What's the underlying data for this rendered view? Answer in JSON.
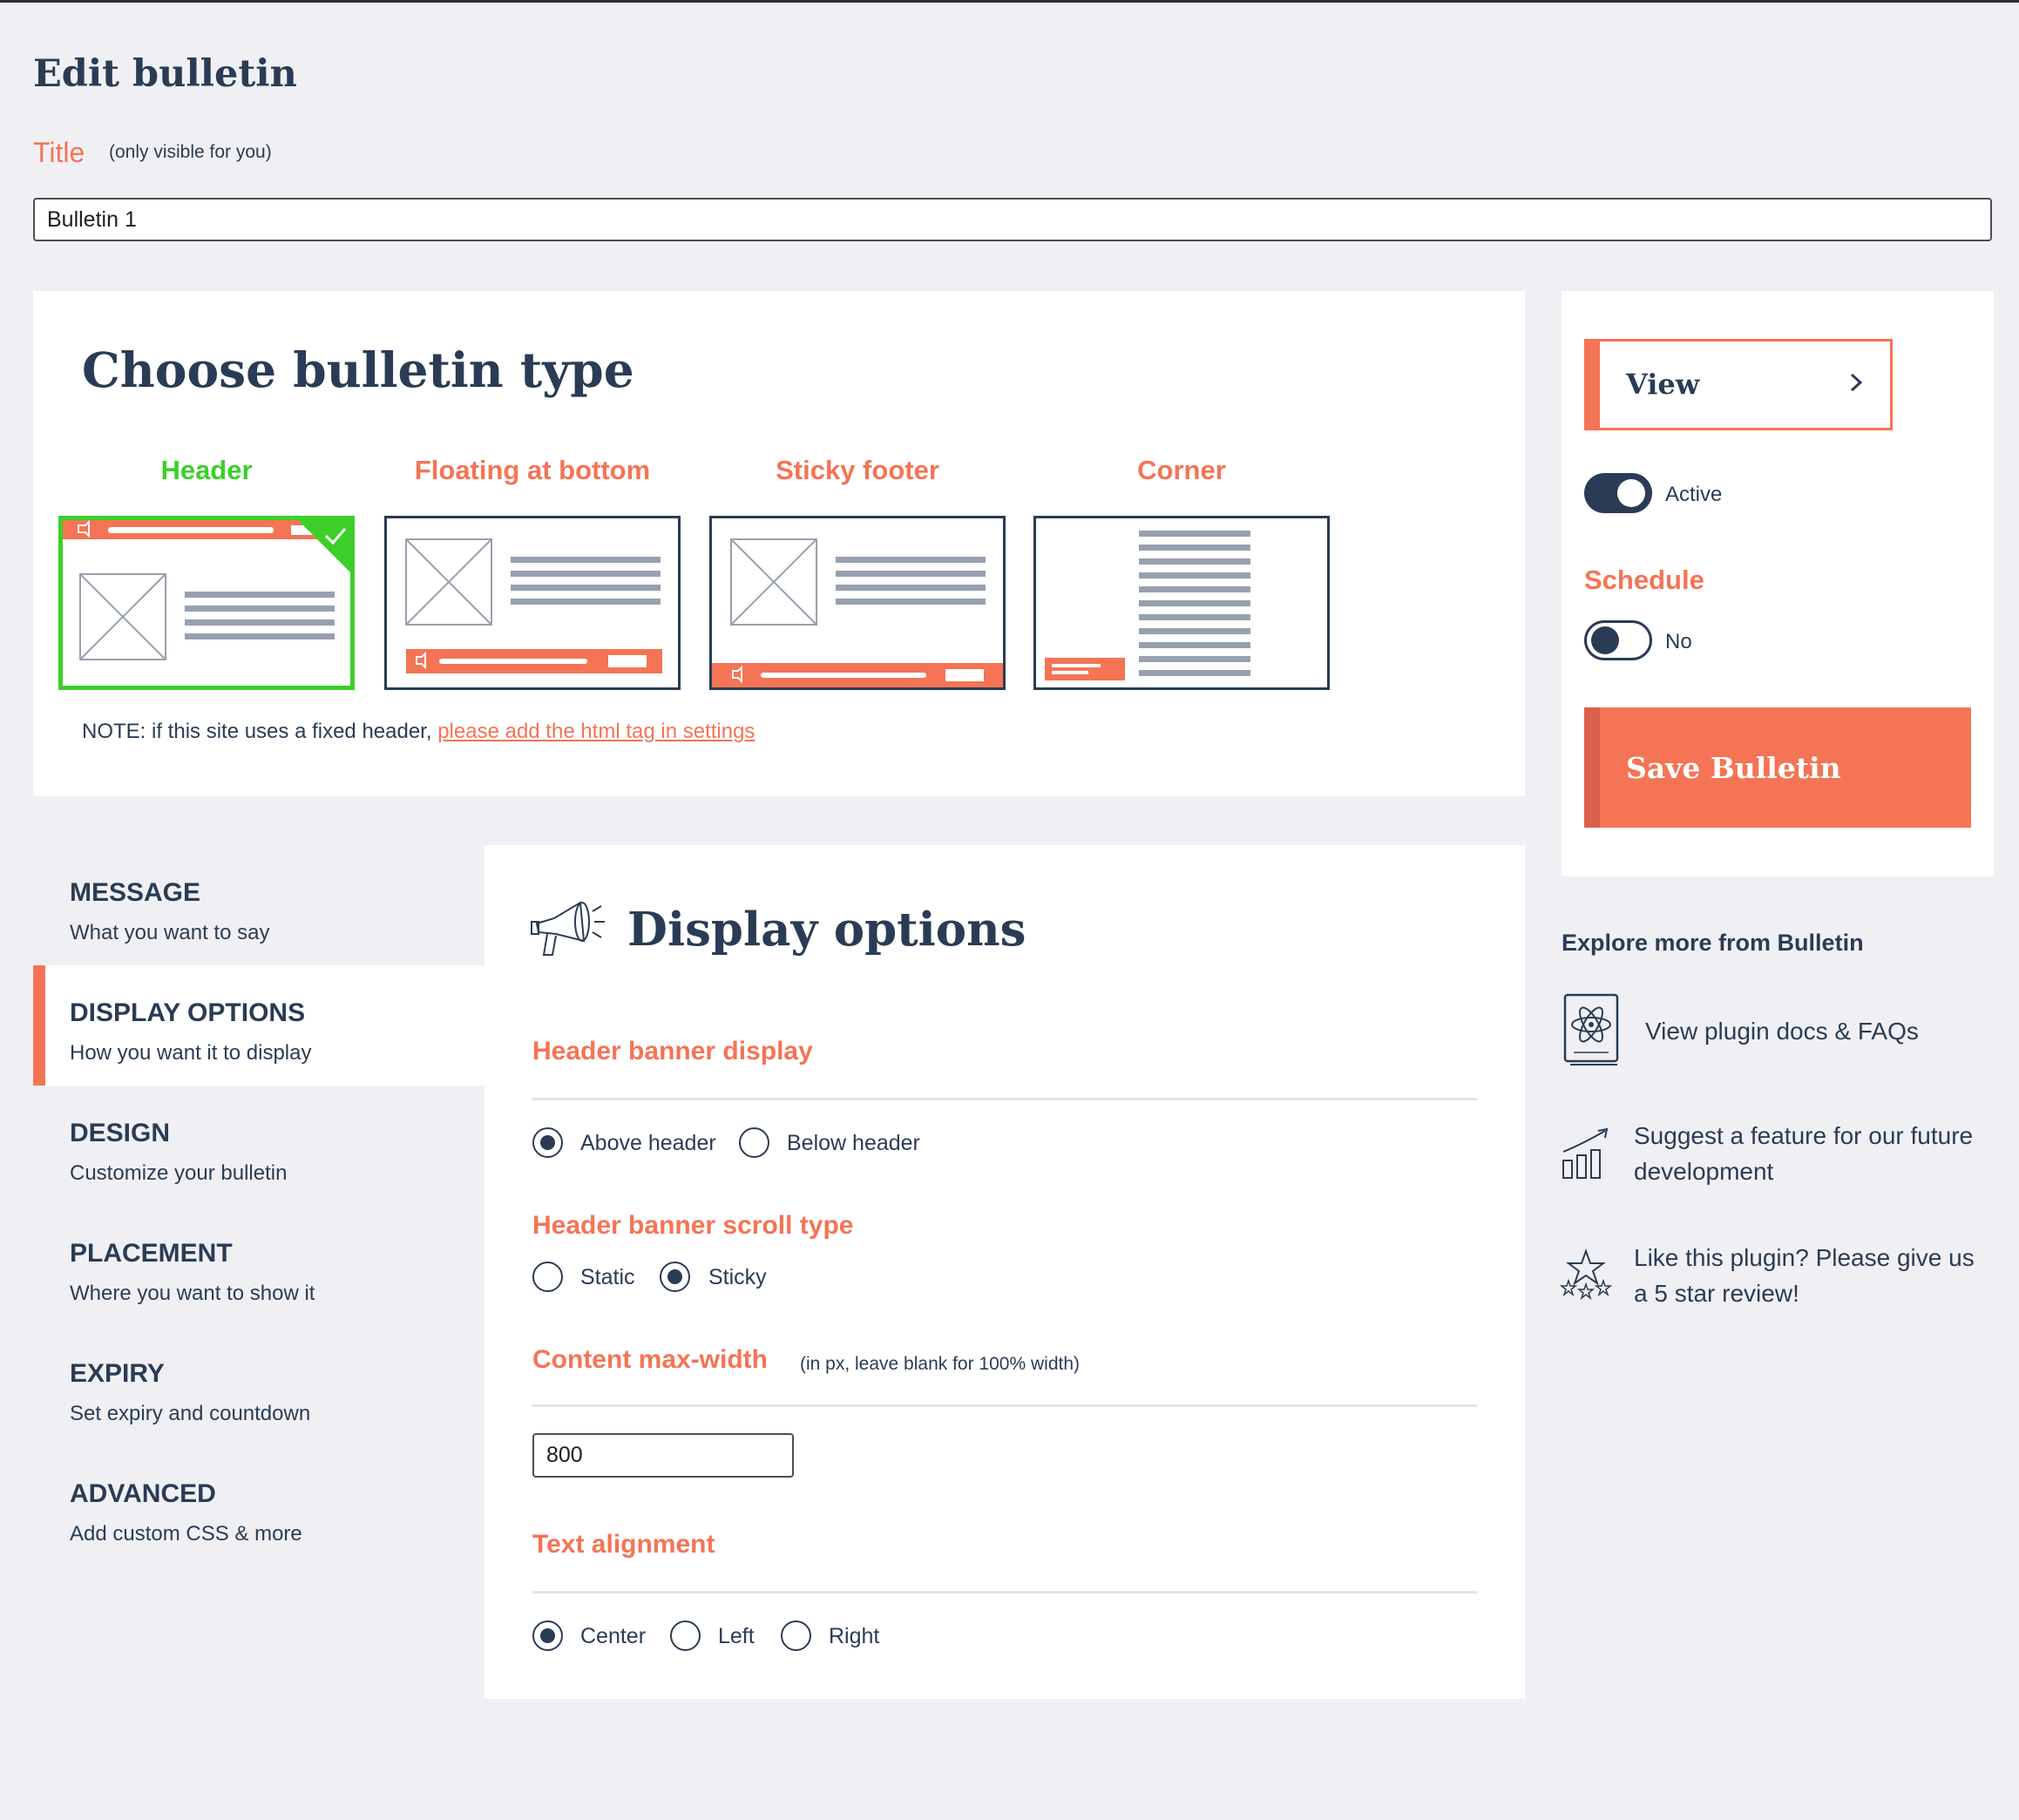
{
  "page": {
    "title": "Edit bulletin"
  },
  "title_field": {
    "label": "Title",
    "hint": "(only visible for you)",
    "value": "Bulletin 1"
  },
  "bulletin_type": {
    "heading": "Choose bulletin type",
    "selected": "Header",
    "options": [
      {
        "label": "Header",
        "color": "#3ccf2a"
      },
      {
        "label": "Floating at bottom",
        "color": "#f47455"
      },
      {
        "label": "Sticky footer",
        "color": "#f47455"
      },
      {
        "label": "Corner",
        "color": "#f47455"
      }
    ],
    "note": "NOTE: if this site uses a fixed header,",
    "note_link": "please add the html tag in settings"
  },
  "sidebar": {
    "view_label": "View",
    "active_label": "Active",
    "active_on": true,
    "schedule_label": "Schedule",
    "schedule_value": "No",
    "schedule_on": false,
    "save_label": "Save Bulletin"
  },
  "explore": {
    "title": "Explore more from Bulletin",
    "items": [
      {
        "label": "View plugin docs & FAQs",
        "icon": "book-atom-icon"
      },
      {
        "label": "Suggest a feature for our future development",
        "icon": "growth-chart-icon"
      },
      {
        "label": "Like this plugin? Please give us a 5 star review!",
        "icon": "stars-icon"
      }
    ]
  },
  "nav": {
    "items": [
      {
        "title": "MESSAGE",
        "subtitle": "What you want to say"
      },
      {
        "title": "DISPLAY OPTIONS",
        "subtitle": "How you want it to display",
        "active": true
      },
      {
        "title": "DESIGN",
        "subtitle": "Customize your bulletin"
      },
      {
        "title": "PLACEMENT",
        "subtitle": "Where you want to show it"
      },
      {
        "title": "EXPIRY",
        "subtitle": "Set expiry and countdown"
      },
      {
        "title": "ADVANCED",
        "subtitle": "Add custom CSS & more"
      }
    ]
  },
  "display_options": {
    "heading": "Display options",
    "header_banner_display": {
      "title": "Header banner display",
      "options": [
        "Above header",
        "Below header"
      ],
      "selected": "Above header"
    },
    "scroll_type": {
      "title": "Header banner scroll type",
      "options": [
        "Static",
        "Sticky"
      ],
      "selected": "Sticky"
    },
    "max_width": {
      "title": "Content max-width",
      "hint": "(in px, leave blank for 100% width)",
      "value": "800"
    },
    "text_alignment": {
      "title": "Text alignment",
      "options": [
        "Center",
        "Left",
        "Right"
      ],
      "selected": "Center"
    }
  },
  "colors": {
    "accent": "#f47455",
    "navy": "#2a3c55",
    "selected_green": "#3ccf2a",
    "background": "#f0f0f4"
  }
}
